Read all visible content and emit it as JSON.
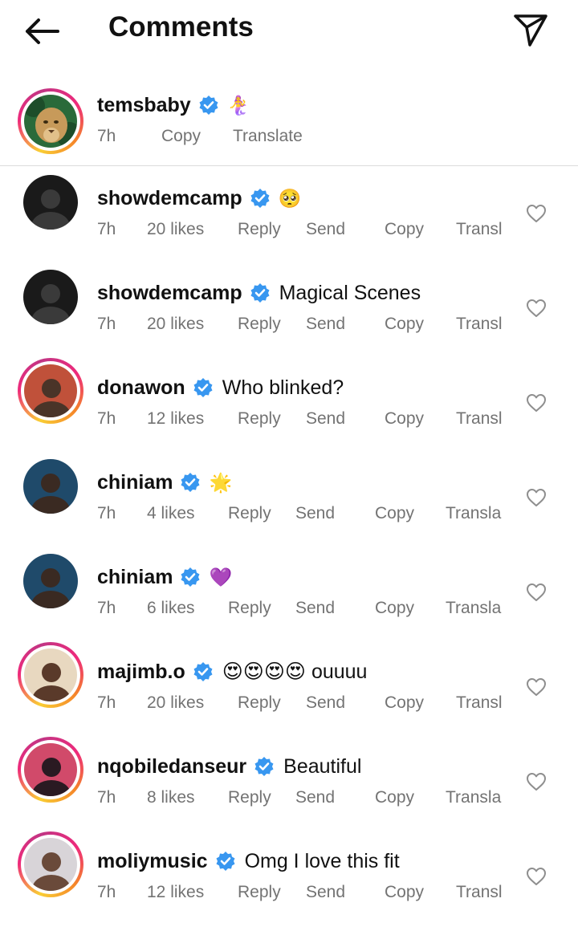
{
  "header": {
    "title": "Comments",
    "back_icon": "arrow-left-icon",
    "share_icon": "paper-plane-icon"
  },
  "caption": {
    "username": "temsbaby",
    "verified": true,
    "text": "🧜‍♀️",
    "time": "7h",
    "copy_label": "Copy",
    "translate_label": "Translate"
  },
  "comments": [
    {
      "username": "showdemcamp",
      "verified": true,
      "text": "🥺",
      "time": "7h",
      "likes": "20 likes",
      "reply": "Reply",
      "send": "Send",
      "copy": "Copy",
      "translate": "Transl"
    },
    {
      "username": "showdemcamp",
      "verified": true,
      "text": "Magical Scenes",
      "time": "7h",
      "likes": "20 likes",
      "reply": "Reply",
      "send": "Send",
      "copy": "Copy",
      "translate": "Transl"
    },
    {
      "username": "donawon",
      "verified": true,
      "text": "Who blinked?",
      "time": "7h",
      "likes": "12 likes",
      "reply": "Reply",
      "send": "Send",
      "copy": "Copy",
      "translate": "Transl"
    },
    {
      "username": "chiniam",
      "verified": true,
      "text": "🌟",
      "time": "7h",
      "likes": "4 likes",
      "reply": "Reply",
      "send": "Send",
      "copy": "Copy",
      "translate": "Transla"
    },
    {
      "username": "chiniam",
      "verified": true,
      "text": "💜",
      "time": "7h",
      "likes": "6 likes",
      "reply": "Reply",
      "send": "Send",
      "copy": "Copy",
      "translate": "Transla"
    },
    {
      "username": "majimb.o",
      "verified": true,
      "text": "😍😍😍😍 ouuuu",
      "time": "7h",
      "likes": "20 likes",
      "reply": "Reply",
      "send": "Send",
      "copy": "Copy",
      "translate": "Transl"
    },
    {
      "username": "nqobiledanseur",
      "verified": true,
      "text": "Beautiful",
      "time": "7h",
      "likes": "8 likes",
      "reply": "Reply",
      "send": "Send",
      "copy": "Copy",
      "translate": "Transla"
    },
    {
      "username": "moliymusic",
      "verified": true,
      "text": "Omg I love this fit",
      "time": "7h",
      "likes": "12 likes",
      "reply": "Reply",
      "send": "Send",
      "copy": "Copy",
      "translate": "Transl"
    }
  ],
  "colors": {
    "verified_blue": "#3897f0",
    "meta_gray": "#737373",
    "divider": "#dbdbdb"
  }
}
